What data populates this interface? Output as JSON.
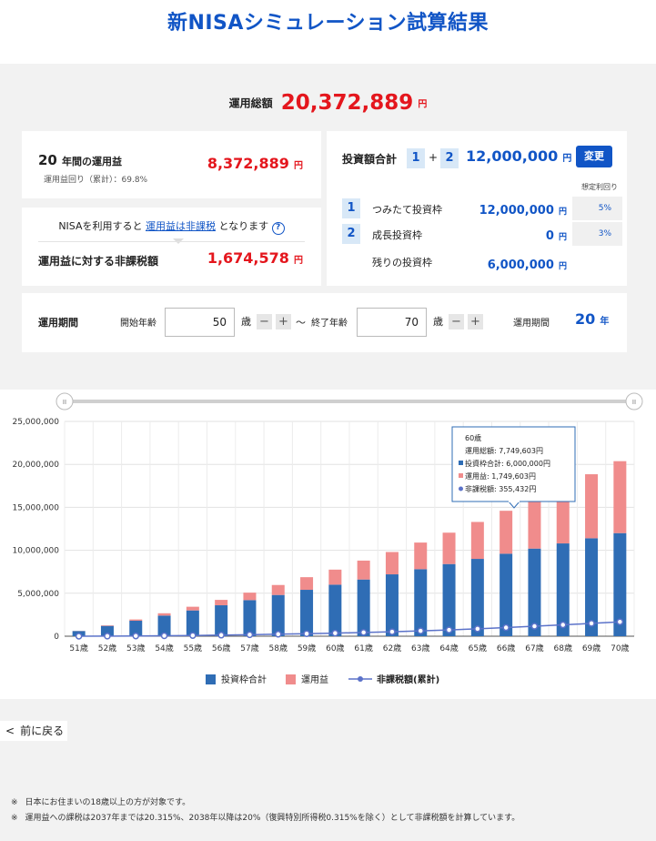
{
  "page": {
    "title": "新NISAシミュレーション試算結果"
  },
  "total": {
    "label": "運用総額",
    "value": "20,372,889",
    "unit": "円"
  },
  "profit": {
    "years": "20",
    "years_label": "年間の運用益",
    "sub": "運用益回り（累計）：69.8%",
    "value": "8,372,889",
    "unit": "円"
  },
  "tax": {
    "note_prefix": "NISAを利用すると",
    "note_link": "運用益は非課税",
    "note_suffix": "となります",
    "help_icon": "?",
    "label": "運用益に対する非課税額",
    "value": "1,674,578",
    "unit": "円"
  },
  "investment": {
    "label": "投資額合計",
    "box1": "1",
    "plus": "+",
    "box2": "2",
    "value": "12,000,000",
    "unit": "円",
    "change_button": "変更",
    "rate_header": "想定利回り",
    "rows": [
      {
        "num": "1",
        "name": "つみたて投資枠",
        "value": "12,000,000",
        "unit": "円",
        "rate": "5%"
      },
      {
        "num": "2",
        "name": "成長投資枠",
        "value": "0",
        "unit": "円",
        "rate": "3%"
      }
    ],
    "remaining_label": "残りの投資枠",
    "remaining_value": "6,000,000",
    "remaining_unit": "円"
  },
  "period": {
    "label": "運用期間",
    "start_label": "開始年齢",
    "start_value": "50",
    "age_unit": "歳",
    "minus": "−",
    "plus": "+",
    "tilde": "〜",
    "end_label": "終了年齢",
    "end_value": "70",
    "period_label": "運用期間",
    "period_value": "20",
    "period_unit": "年"
  },
  "chart_data": {
    "type": "bar",
    "categories": [
      "51歳",
      "52歳",
      "53歳",
      "54歳",
      "55歳",
      "56歳",
      "57歳",
      "58歳",
      "59歳",
      "60歳",
      "61歳",
      "62歳",
      "63歳",
      "64歳",
      "65歳",
      "66歳",
      "67歳",
      "68歳",
      "69歳",
      "70歳"
    ],
    "series": [
      {
        "name": "投資枠合計",
        "color": "#2f6db5",
        "values": [
          600000,
          1200000,
          1800000,
          2400000,
          3000000,
          3600000,
          4200000,
          4800000,
          5400000,
          6000000,
          6600000,
          7200000,
          7800000,
          8400000,
          9000000,
          9600000,
          10200000,
          10800000,
          11400000,
          12000000
        ]
      },
      {
        "name": "運用益",
        "color": "#f08c8c",
        "values": [
          16000,
          65000,
          150000,
          270000,
          430000,
          630000,
          870000,
          1160000,
          1470000,
          1749603,
          2200000,
          2600000,
          3100000,
          3650000,
          4300000,
          5000000,
          5800000,
          6600000,
          7450000,
          8372889
        ]
      },
      {
        "name": "非課税額(累計)",
        "type": "line",
        "color": "#5b72c9",
        "values": [
          3200,
          13000,
          30000,
          54000,
          86000,
          126000,
          174000,
          232000,
          294000,
          355432,
          440000,
          520000,
          620000,
          730000,
          860000,
          1000000,
          1160000,
          1320000,
          1490000,
          1674578
        ]
      }
    ],
    "yticks": [
      "0",
      "5,000,000",
      "10,000,000",
      "15,000,000",
      "20,000,000",
      "25,000,000"
    ],
    "ylim": [
      0,
      25000000
    ],
    "grid": true,
    "legend": "bottom",
    "tooltip": {
      "title": "60歳",
      "total": "運用総額: 7,749,603円",
      "invest": "投資枠合計: 6,000,000円",
      "profit": "運用益: 1,749,603円",
      "tax": "非課税額: 355,432円"
    },
    "slider_left": "II",
    "slider_right": "II"
  },
  "nav": {
    "back_icon": "<",
    "back_label": "前に戻る"
  },
  "notes": {
    "mark": "※",
    "line1": "日本にお住まいの18歳以上の方が対象です。",
    "line2": "運用益への課税は2037年までは20.315%、2038年以降は20%（復興特別所得税0.315%を除く）として非課税額を計算しています。"
  }
}
